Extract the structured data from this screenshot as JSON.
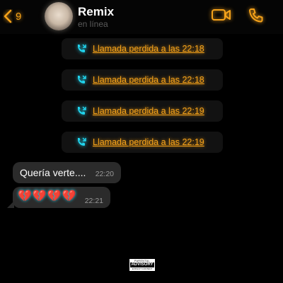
{
  "header": {
    "back_count": "9",
    "contact_name": "Remix",
    "status": "en línea",
    "accent_color": "#f5a21a"
  },
  "messages": {
    "missed_calls": [
      {
        "text": "Llamada perdida a las 22:18",
        "icon": "missed-video-call-icon"
      },
      {
        "text": "Llamada perdida a las 22:18",
        "icon": "missed-video-call-icon"
      },
      {
        "text": "Llamada perdida a las 22:19",
        "icon": "missed-video-call-icon"
      },
      {
        "text": "Llamada perdida a las 22:19",
        "icon": "missed-video-call-icon"
      }
    ],
    "incoming": [
      {
        "text": "Quería verte....",
        "time": "22:20"
      },
      {
        "text": "💔💔💔💔",
        "time": "22:21"
      }
    ],
    "call_icon_color": "#21d4ee"
  },
  "advisory": {
    "top": "PARENTAL",
    "middle": "ADVISORY",
    "bottom": "EXPLICIT CONTENT"
  }
}
